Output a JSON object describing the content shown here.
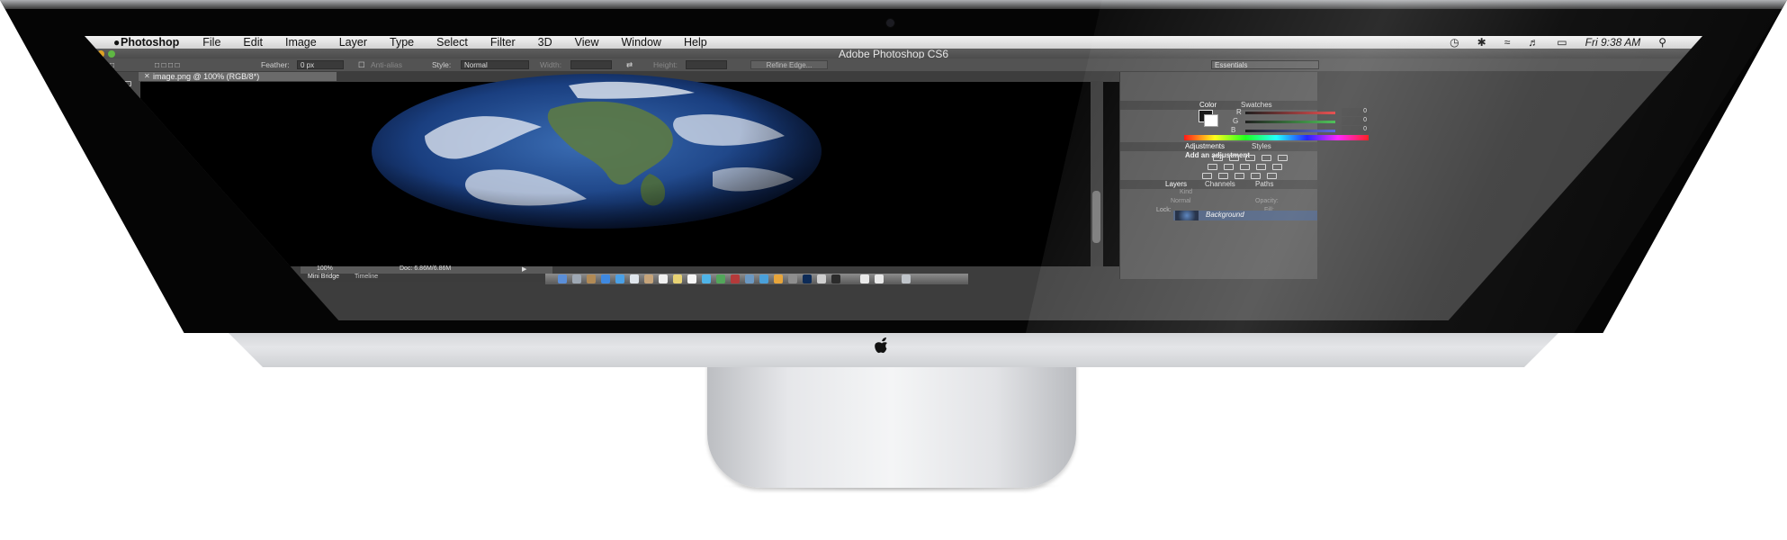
{
  "menubar": {
    "app_name": "Photoshop",
    "items": [
      "File",
      "Edit",
      "Image",
      "Layer",
      "Type",
      "Select",
      "Filter",
      "3D",
      "View",
      "Window",
      "Help"
    ],
    "clock": "Fri 9:38 AM"
  },
  "window": {
    "title": "Adobe Photoshop CS6"
  },
  "options_bar": {
    "feather_label": "Feather:",
    "feather_value": "0 px",
    "antialias_label": "Anti-alias",
    "style_label": "Style:",
    "style_value": "Normal",
    "width_label": "Width:",
    "height_label": "Height:",
    "refine_edge_label": "Refine Edge...",
    "workspace_value": "Essentials"
  },
  "document": {
    "tab_label": "image.png @ 100% (RGB/8*)",
    "zoom": "100%",
    "doc_info": "Doc: 6.86M/6.86M"
  },
  "bottom_panel": {
    "tabs": [
      "Mini Bridge",
      "Timeline"
    ]
  },
  "panels": {
    "color_tabs": [
      "Color",
      "Swatches"
    ],
    "color_channels": [
      {
        "label": "R",
        "value": "0",
        "color": "#e23232"
      },
      {
        "label": "G",
        "value": "0",
        "color": "#2fb53a"
      },
      {
        "label": "B",
        "value": "0",
        "color": "#3a4ee0"
      }
    ],
    "adjust_tabs": [
      "Adjustments",
      "Styles"
    ],
    "add_adjustment": "Add an adjustment",
    "layer_tabs": [
      "Layers",
      "Channels",
      "Paths"
    ],
    "kind_label": "Kind",
    "blend_mode": "Normal",
    "opacity_label": "Opacity:",
    "lock_label": "Lock:",
    "fill_label": "Fill:",
    "layer_name": "Background"
  },
  "colors": {
    "bezel": "#050505",
    "aluminum": "#d7d8db",
    "ps_gray": "#535353",
    "selected_layer": "#44587a"
  }
}
